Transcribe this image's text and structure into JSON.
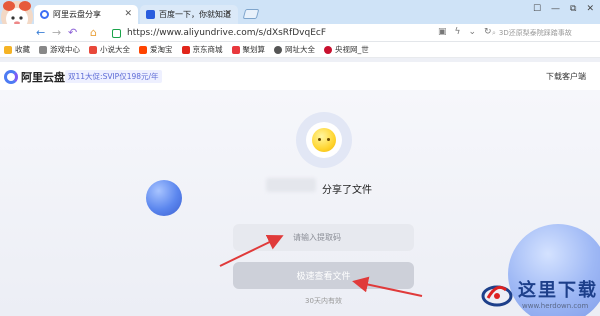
{
  "tabs": [
    {
      "label": "阿里云盘分享",
      "favicon_color": "#3d6ef5",
      "active": true
    },
    {
      "label": "百度一下，你就知道",
      "favicon_color": "#2a5dde",
      "active": false
    }
  ],
  "window_controls": [
    "☐",
    "—",
    "⧉",
    "✕"
  ],
  "address": {
    "url": "https://www.aliyundrive.com/s/dXsRfDvqEcF",
    "search_placeholder": "3D还原梨泰院踩踏事故"
  },
  "bookmarks": [
    {
      "label": "收藏",
      "icon": "star-icon",
      "color": "#f5b324"
    },
    {
      "label": "游戏中心",
      "icon": "game-icon",
      "color": "#888888"
    },
    {
      "label": "小说大全",
      "icon": "book-icon",
      "color": "#e8483a"
    },
    {
      "label": "爱淘宝",
      "icon": "taobao-icon",
      "color": "#ff4400"
    },
    {
      "label": "京东商城",
      "icon": "jd-icon",
      "color": "#e1251b"
    },
    {
      "label": "聚划算",
      "icon": "juhuasuan-icon",
      "color": "#e8383d"
    },
    {
      "label": "网址大全",
      "icon": "globe-icon",
      "color": "#555555"
    },
    {
      "label": "央视网_世",
      "icon": "cctv-icon",
      "color": "#c8102e"
    }
  ],
  "site": {
    "logo_text": "阿里云盘",
    "promo": "双11大促:SVIP仅198元/年",
    "download_label": "下载客户端",
    "brand_color": "#4d7bf3"
  },
  "share": {
    "share_text": "分享了文件",
    "code_placeholder": "请输入提取码",
    "open_button": "极速查看文件",
    "validity_text": "30天内有效"
  },
  "watermark": {
    "title": "这里下载",
    "url": "www.herdown.com"
  },
  "annotation_color": "#e03a3a"
}
